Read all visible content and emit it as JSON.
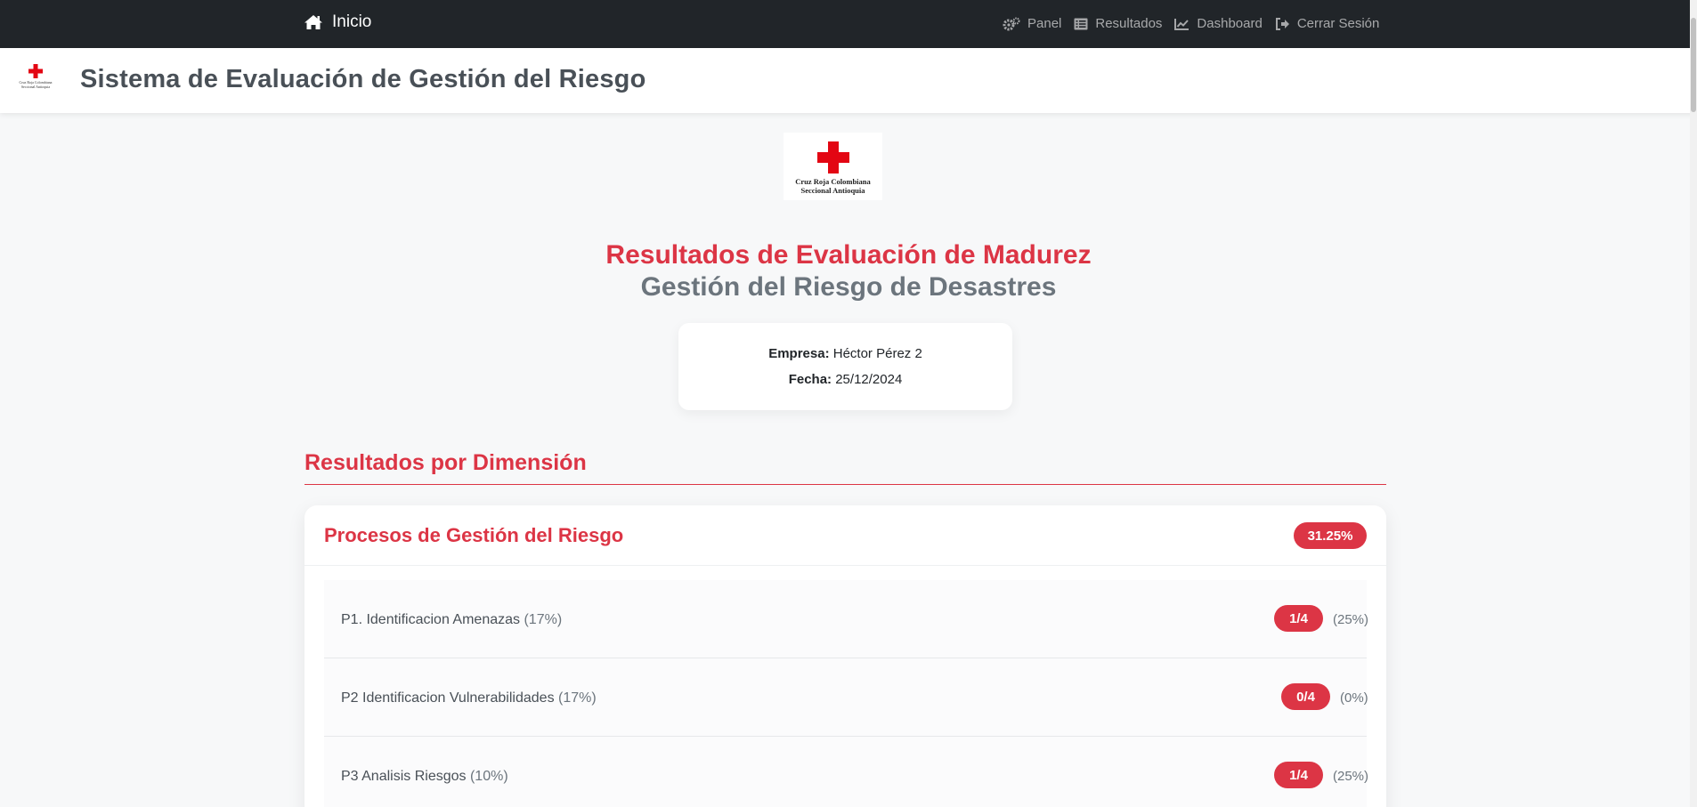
{
  "nav": {
    "home_label": "Inicio",
    "links": [
      {
        "label": "Panel",
        "icon": "cogs-icon"
      },
      {
        "label": "Resultados",
        "icon": "list-icon"
      },
      {
        "label": "Dashboard",
        "icon": "line-chart-icon"
      },
      {
        "label": "Cerrar Sesión",
        "icon": "sign-out-icon"
      }
    ]
  },
  "header": {
    "title": "Sistema de Evaluación de Gestión del Riesgo",
    "logo_text_line1": "Cruz Roja Colombiana",
    "logo_text_line2": "Seccional Antioquia"
  },
  "main": {
    "logo_text_line1": "Cruz Roja Colombiana",
    "logo_text_line2": "Seccional Antioquia",
    "heading": "Resultados de Evaluación de Madurez",
    "subheading": "Gestión del Riesgo de Desastres",
    "info": {
      "empresa_label": "Empresa:",
      "empresa_value": "Héctor Pérez 2",
      "fecha_label": "Fecha:",
      "fecha_value": "25/12/2024"
    },
    "section_title": "Resultados por Dimensión",
    "dimension": {
      "name": "Procesos de Gestión del Riesgo",
      "score": "31.25%",
      "items": [
        {
          "label": "P1. Identificacion Amenazas",
          "weight": "(17%)",
          "score": "1/4",
          "percent": "(25%)"
        },
        {
          "label": "P2 Identificacion Vulnerabilidades",
          "weight": "(17%)",
          "score": "0/4",
          "percent": "(0%)"
        },
        {
          "label": "P3 Analisis Riesgos",
          "weight": "(10%)",
          "score": "1/4",
          "percent": "(25%)"
        }
      ]
    }
  },
  "colors": {
    "brand_red": "#dc3545",
    "navbar": "#212529",
    "muted": "#6c757d"
  }
}
